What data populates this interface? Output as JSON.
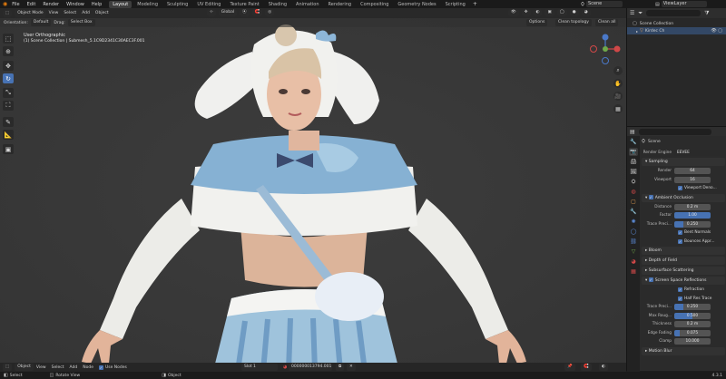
{
  "topbar": {
    "menus": [
      "File",
      "Edit",
      "Render",
      "Window",
      "Help"
    ],
    "workspaces": [
      "Layout",
      "Modeling",
      "Sculpting",
      "UV Editing",
      "Texture Paint",
      "Shading",
      "Animation",
      "Rendering",
      "Compositing",
      "Geometry Nodes",
      "Scripting"
    ],
    "active_workspace": "Layout",
    "scene": "Scene",
    "view_layer": "ViewLayer"
  },
  "viewport": {
    "mode": "Object Mode",
    "menus": [
      "View",
      "Select",
      "Add",
      "Object"
    ],
    "transform_orientation": "Global",
    "orientation_label": "Orientation:",
    "orientation_value": "Default",
    "drag_label": "Drag:",
    "drag_value": "Select Box",
    "options_label": "Options",
    "clean_topology": "Clean topology",
    "clean_all": "Clean all",
    "view_name": "User Orthographic",
    "collection_path": "(1) Scene Collection | Submesh_5.1C9D2341C30AEC3F.001"
  },
  "outliner": {
    "title": "Scene Collection",
    "item": "Kirdec Ch"
  },
  "properties": {
    "scene_label": "Scene",
    "render_engine_label": "Render Engine",
    "render_engine": "EEVEE",
    "sampling": {
      "title": "Sampling",
      "render_label": "Render",
      "render": "64",
      "viewport_label": "Viewport",
      "viewport": "16",
      "viewport_denoise": "Viewport Deno..."
    },
    "ao": {
      "title": "Ambient Occlusion",
      "distance_label": "Distance",
      "distance": "0.2 m",
      "factor_label": "Factor",
      "factor": "1.00",
      "precision_label": "Trace Preci...",
      "precision": "0.250",
      "bent_normals": "Bent Normals",
      "bounces": "Bounces Appr..."
    },
    "bloom": "Bloom",
    "dof": "Depth of Field",
    "sss": "Subsurface Scattering",
    "ssr": {
      "title": "Screen Space Reflections",
      "refraction": "Refraction",
      "half_res": "Half Res Trace",
      "precision_label": "Trace Preci...",
      "precision": "0.250",
      "max_rough_label": "Max Roug...",
      "max_rough": "0.500",
      "thickness_label": "Thickness",
      "thickness": "0.2 m",
      "edge_label": "Edge Fading",
      "edge": "0.075",
      "clamp_label": "Clamp",
      "clamp": "10.000"
    },
    "motion_blur": "Motion Blur"
  },
  "bottombar": {
    "mode": "Object",
    "menus": [
      "View",
      "Select",
      "Add",
      "Node"
    ],
    "use_nodes": "Use Nodes",
    "slot": "Slot 1",
    "material": "000000013794.001"
  },
  "statusbar": {
    "left": "Select",
    "middle": "Rotate View",
    "right": "Object",
    "version": "4.3.1"
  },
  "colors": {
    "accent": "#4772b3",
    "viewport_bg": "#393939"
  }
}
